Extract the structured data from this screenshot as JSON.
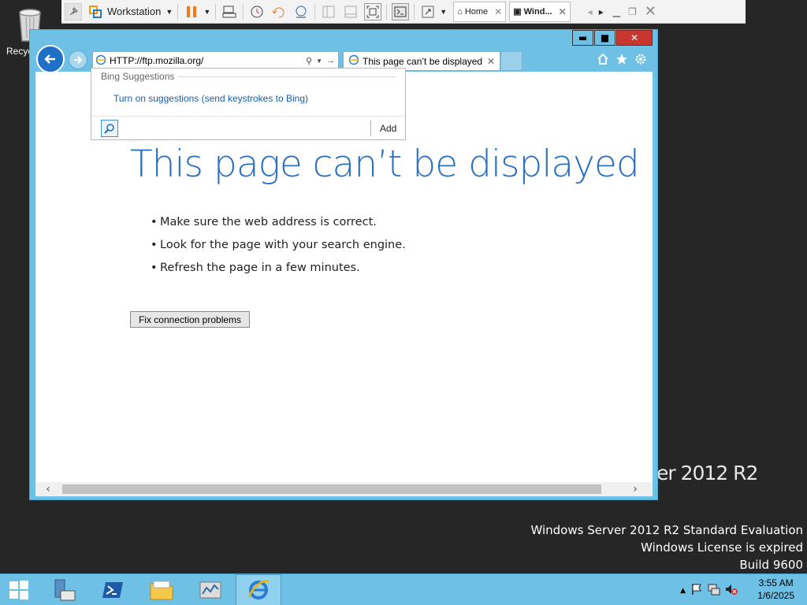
{
  "desktop": {
    "recycle_bin_label": "Recyc",
    "branding": "er 2012 R2",
    "eval_lines": [
      "Windows Server 2012 R2 Standard Evaluation",
      "Windows License is expired",
      "Build 9600"
    ]
  },
  "vmware": {
    "workstation_label": "Workstation",
    "tabs": [
      {
        "label": "Home"
      },
      {
        "label": "Wind..."
      }
    ]
  },
  "browser": {
    "address": {
      "url": "HTTP://ftp.mozilla.org/"
    },
    "tab": {
      "title": "This page can’t be displayed"
    },
    "page": {
      "headline": "This page can’t be displayed",
      "bullets": [
        "Make sure the web address is correct.",
        "Look for the page with your search engine.",
        "Refresh the page in a few minutes."
      ],
      "fix_button": "Fix connection problems"
    },
    "suggestions": {
      "header": "Bing Suggestions",
      "link": "Turn on suggestions (send keystrokes to Bing)",
      "add_label": "Add"
    }
  },
  "taskbar": {
    "time": "3:55 AM",
    "date": "1/6/2025"
  },
  "colors": {
    "accent": "#6ec1e4",
    "headline": "#2b6fbf",
    "link": "#1a5fa8",
    "close": "#c7372f"
  }
}
